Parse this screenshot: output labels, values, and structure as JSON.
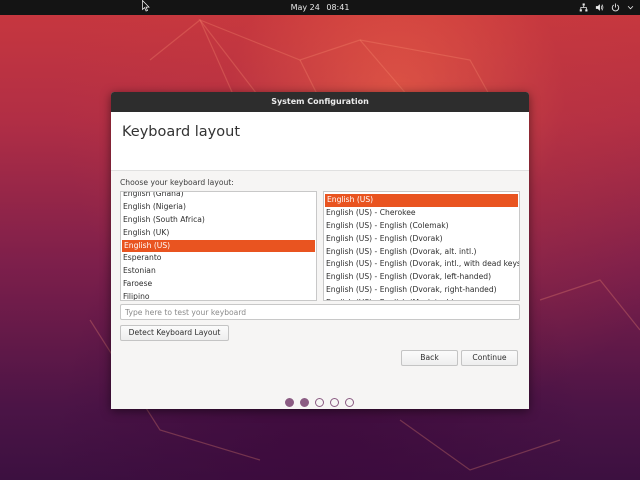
{
  "topbar": {
    "date": "May 24",
    "time": "08:41",
    "tray_icons": [
      "network-icon",
      "volume-icon",
      "power-icon",
      "chevron-down-icon"
    ]
  },
  "window": {
    "title": "System Configuration",
    "page_title": "Keyboard layout",
    "prompt": "Choose your keyboard layout:",
    "layouts": [
      "English (Ghana)",
      "English (Nigeria)",
      "English (South Africa)",
      "English (UK)",
      "English (US)",
      "Esperanto",
      "Estonian",
      "Faroese",
      "Filipino"
    ],
    "selected_layout": "English (US)",
    "variants": [
      "English (US)",
      "English (US) - Cherokee",
      "English (US) - English (Colemak)",
      "English (US) - English (Dvorak)",
      "English (US) - English (Dvorak, alt. intl.)",
      "English (US) - English (Dvorak, intl., with dead keys)",
      "English (US) - English (Dvorak, left-handed)",
      "English (US) - English (Dvorak, right-handed)",
      "English (US) - English (Macintosh)"
    ],
    "selected_variant": "English (US)",
    "test_input": {
      "value": "",
      "placeholder": "Type here to test your keyboard"
    },
    "detect_label": "Detect Keyboard Layout",
    "back_label": "Back",
    "continue_label": "Continue",
    "progress": {
      "total_steps": 5,
      "completed_steps": 2
    }
  },
  "colors": {
    "accent": "#e95420",
    "titlebar": "#2d2d2d",
    "topbar": "#141414",
    "progress_dot": "#8b5c83"
  }
}
